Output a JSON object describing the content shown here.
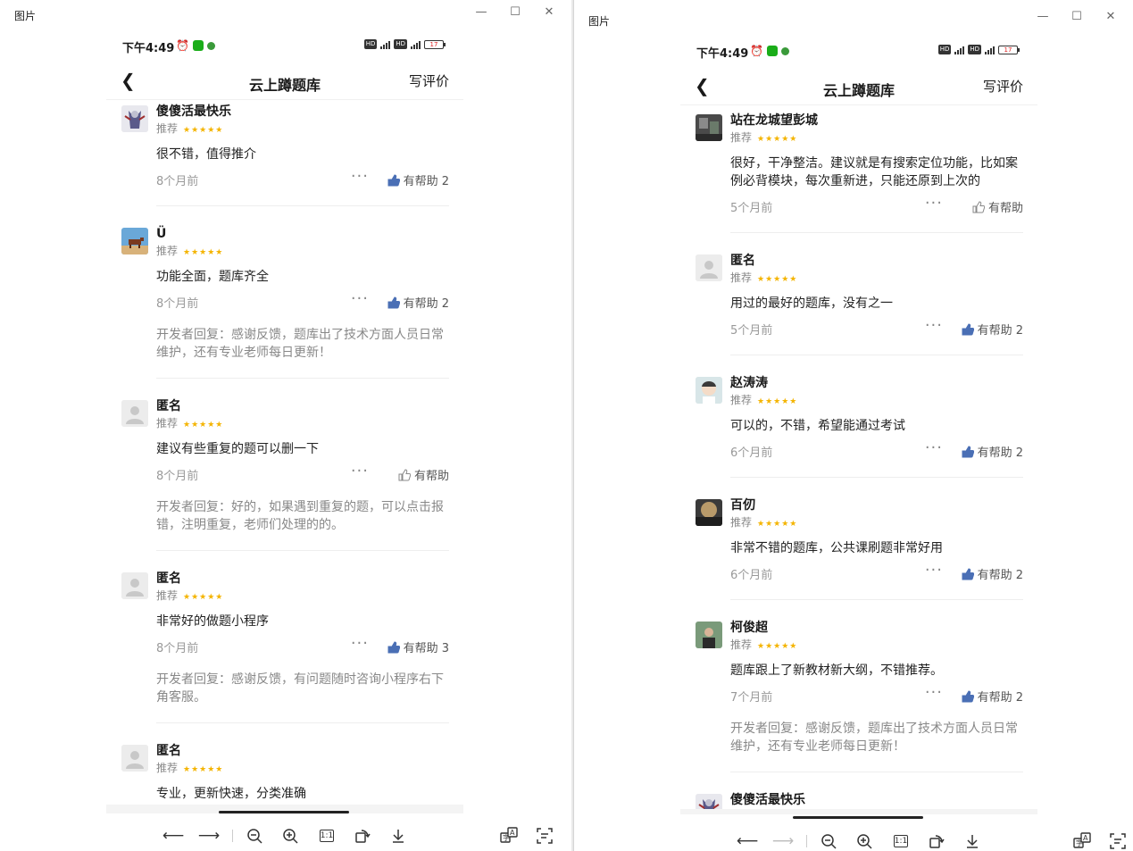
{
  "window_left": {
    "title": "图片",
    "controls": {
      "minimize": "—",
      "maximize": "☐",
      "close": "✕"
    },
    "phone": {
      "status": {
        "time": "下午4:49",
        "battery": "17"
      },
      "navbar": {
        "title": "云上蹲题库",
        "action": "写评价"
      },
      "reviews": [
        {
          "name": "傻傻活最快乐",
          "rec": "推荐",
          "text": "很不错，值得推介",
          "time": "8个月前",
          "help": "有帮助 2",
          "liked": true,
          "reply": "",
          "avatar": "figure"
        },
        {
          "name": "Ü",
          "rec": "推荐",
          "text": "功能全面，题库齐全",
          "time": "8个月前",
          "help": "有帮助 2",
          "liked": true,
          "reply": "开发者回复：感谢反馈，题库出了技术方面人员日常维护，还有专业老师每日更新！",
          "avatar": "cow"
        },
        {
          "name": "匿名",
          "rec": "推荐",
          "text": "建议有些重复的题可以删一下",
          "time": "8个月前",
          "help": "有帮助",
          "liked": false,
          "reply": "开发者回复：好的，如果遇到重复的题，可以点击报错，注明重复，老师们处理的的。",
          "avatar": "default"
        },
        {
          "name": "匿名",
          "rec": "推荐",
          "text": "非常好的做题小程序",
          "time": "8个月前",
          "help": "有帮助 3",
          "liked": true,
          "reply": "开发者回复：感谢反馈，有问题随时咨询小程序右下角客服。",
          "avatar": "default"
        },
        {
          "name": "匿名",
          "rec": "推荐",
          "text": "专业，更新快速，分类准确",
          "time": "",
          "help": "",
          "liked": false,
          "reply": "",
          "avatar": "default"
        }
      ]
    }
  },
  "window_right": {
    "title": "图片",
    "controls": {
      "minimize": "—",
      "maximize": "☐",
      "close": "✕"
    },
    "phone": {
      "status": {
        "time": "下午4:49",
        "battery": "17"
      },
      "navbar": {
        "title": "云上蹲题库",
        "action": "写评价"
      },
      "reviews": [
        {
          "name": "站在龙城望彭城",
          "rec": "推荐",
          "text": "很好，干净整洁。建议就是有搜索定位功能，比如案例必背模块，每次重新进，只能还原到上次的",
          "time": "5个月前",
          "help": "有帮助",
          "liked": false,
          "reply": "",
          "avatar": "photo"
        },
        {
          "name": "匿名",
          "rec": "推荐",
          "text": "用过的最好的题库，没有之一",
          "time": "5个月前",
          "help": "有帮助 2",
          "liked": true,
          "reply": "",
          "avatar": "default"
        },
        {
          "name": "赵涛涛",
          "rec": "推荐",
          "text": "可以的，不错，希望能通过考试",
          "time": "6个月前",
          "help": "有帮助 2",
          "liked": true,
          "reply": "",
          "avatar": "cartoon"
        },
        {
          "name": "百仞",
          "rec": "推荐",
          "text": "非常不错的题库，公共课刷题非常好用",
          "time": "6个月前",
          "help": "有帮助 2",
          "liked": true,
          "reply": "",
          "avatar": "sky"
        },
        {
          "name": "柯俊超",
          "rec": "推荐",
          "text": "题库跟上了新教材新大纲，不错推荐。",
          "time": "7个月前",
          "help": "有帮助 2",
          "liked": true,
          "reply": "开发者回复：感谢反馈，题库出了技术方面人员日常维护，还有专业老师每日更新！",
          "avatar": "man"
        },
        {
          "name": "傻傻活最快乐",
          "rec": "",
          "text": "",
          "time": "",
          "help": "",
          "liked": false,
          "reply": "",
          "avatar": "figure"
        }
      ]
    }
  },
  "toolbar": {
    "back_icon": "arrow-left-icon",
    "forward_icon": "arrow-right-icon",
    "zoom_out_icon": "zoom-out-icon",
    "zoom_in_icon": "zoom-in-icon",
    "actual_size_label": "1:1",
    "rotate_icon": "rotate-icon",
    "download_icon": "download-icon",
    "translate_icon": "translate-icon",
    "ocr_icon": "ocr-icon"
  },
  "colors": {
    "star": "#f4b400",
    "like": "#4a6fb5",
    "text_muted": "#999999"
  }
}
